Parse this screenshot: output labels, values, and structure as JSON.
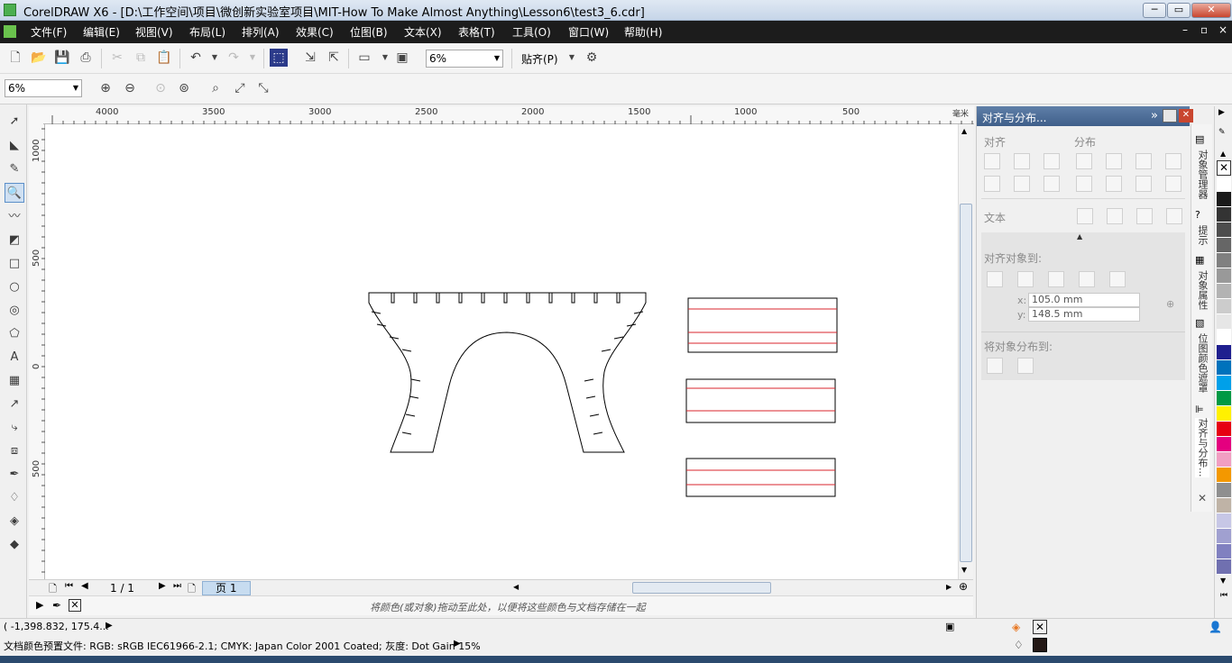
{
  "window": {
    "title": "CorelDRAW X6 - [D:\\工作空间\\项目\\微创新实验室项目\\MIT-How To Make Almost Anything\\Lesson6\\test3_6.cdr]",
    "btn_min": "─",
    "btn_max": "▭",
    "btn_close": "✕"
  },
  "menu": {
    "items": [
      "文件(F)",
      "编辑(E)",
      "视图(V)",
      "布局(L)",
      "排列(A)",
      "效果(C)",
      "位图(B)",
      "文本(X)",
      "表格(T)",
      "工具(O)",
      "窗口(W)",
      "帮助(H)"
    ],
    "mdi_min": "–",
    "mdi_restore": "▫",
    "mdi_close": "×"
  },
  "toolbar": {
    "zoom_value": "6%",
    "snap_label": "贴齐(P)"
  },
  "zoombar": {
    "zoom_value": "6%"
  },
  "ruler": {
    "h_labels": [
      "4000",
      "3500",
      "3000",
      "2500",
      "2000",
      "1500",
      "1000",
      "500"
    ],
    "unit": "毫米",
    "v_labels": [
      "1000",
      "500",
      "0",
      "500"
    ]
  },
  "pagenav": {
    "counter": "1 / 1",
    "page_tab": "页 1"
  },
  "palette_tray": {
    "hint": "将颜色(或对象)拖动至此处，以便将这些颜色与文档存储在一起"
  },
  "docker": {
    "title": "对齐与分布...",
    "expand": "»",
    "section_align": "对齐",
    "section_distribute": "分布",
    "section_text": "文本",
    "align_to": "对齐对象到:",
    "x_label": "x:",
    "x_value": "105.0 mm",
    "y_label": "y:",
    "y_value": "148.5 mm",
    "distribute_to": "将对象分布到:"
  },
  "sidetabs": [
    "对象管理器",
    "提示",
    "对象属性",
    "位图颜色遮罩",
    "对齐与分布..."
  ],
  "palette_colors": [
    "#ffffff",
    "#1a1a1a",
    "#333333",
    "#4d4d4d",
    "#666666",
    "#808080",
    "#999999",
    "#b3b3b3",
    "#cccccc",
    "#e6e6e6",
    "#ffffff",
    "#1f1f8f",
    "#0072bc",
    "#00a0e9",
    "#009944",
    "#fff100",
    "#e60012",
    "#e4007f",
    "#f19ec2",
    "#f39800",
    "#8f8f8f",
    "#bfb3a6",
    "#c7c7e6",
    "#a0a0d0",
    "#8080c0",
    "#7070b0"
  ],
  "status": {
    "coords": "( -1,398.832, 175.4... ",
    "color_profile": "文档颜色预置文件: RGB: sRGB IEC61966-2.1; CMYK: Japan Color 2001 Coated; 灰度: Dot Gain 15% "
  }
}
